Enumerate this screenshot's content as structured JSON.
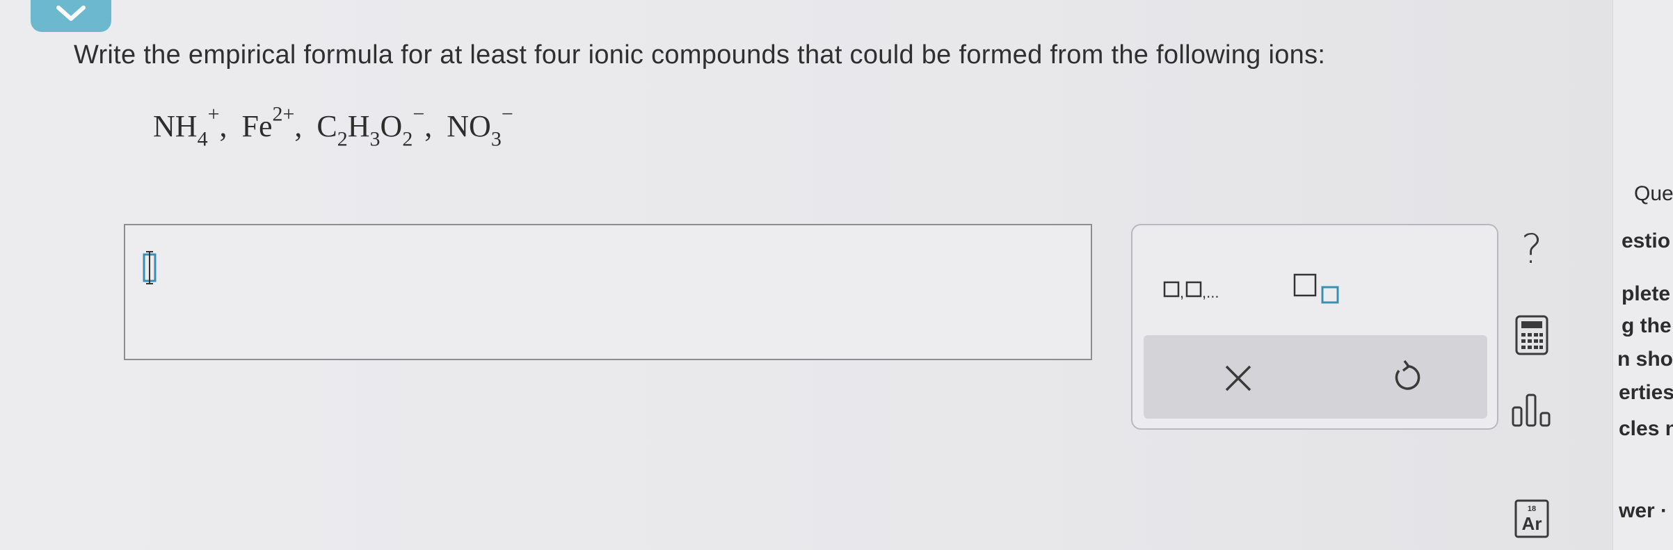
{
  "question": {
    "prompt": "Write the empirical formula for at least four ionic compounds that could be formed from the following ions:"
  },
  "ions": [
    {
      "base": "NH",
      "sub": "4",
      "sup": "+"
    },
    {
      "base": "Fe",
      "sub": "",
      "sup": "2+"
    },
    {
      "base1": "C",
      "sub1": "2",
      "base2": "H",
      "sub2": "3",
      "base3": "O",
      "sub3": "2",
      "sup": "−"
    },
    {
      "base": "NO",
      "sub": "3",
      "sup": "−"
    }
  ],
  "ion_separator": ",",
  "keypad": {
    "list_button_label": "□,□,...",
    "subscript_button_label": "□□",
    "clear_label": "×",
    "undo_label": "↺"
  },
  "tools": {
    "help_label": "?",
    "periodic_number": "18",
    "periodic_symbol": "Ar"
  },
  "right_panel": {
    "lines": [
      "Que",
      "estio",
      "plete",
      "g the",
      "n sho",
      "erties",
      "cles n",
      "wer ·"
    ]
  }
}
